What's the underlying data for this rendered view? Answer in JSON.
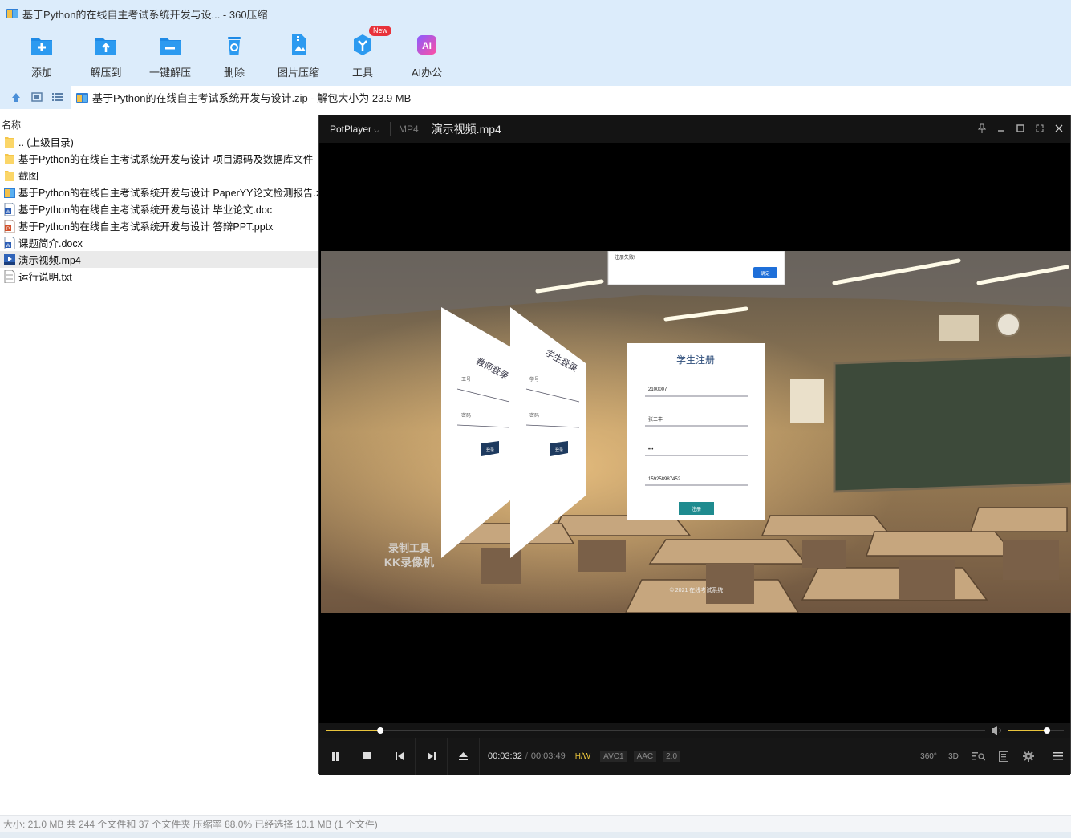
{
  "window": {
    "title": "基于Python的在线自主考试系统开发与设... - 360压缩"
  },
  "toolbar": {
    "items": [
      {
        "label": "添加",
        "icon": "add-icon"
      },
      {
        "label": "解压到",
        "icon": "extract-to-icon"
      },
      {
        "label": "一键解压",
        "icon": "one-click-extract-icon"
      },
      {
        "label": "删除",
        "icon": "delete-icon"
      },
      {
        "label": "图片压缩",
        "icon": "image-compress-icon"
      },
      {
        "label": "工具",
        "icon": "tools-icon",
        "badge": "New"
      },
      {
        "label": "AI办公",
        "icon": "ai-office-icon",
        "glyph": "AI"
      }
    ]
  },
  "address": {
    "path": "基于Python的在线自主考试系统开发与设计.zip - 解包大小为 23.9 MB"
  },
  "filelist": {
    "column_name": "名称",
    "rows": [
      {
        "name": ".. (上级目录)",
        "type": "folder"
      },
      {
        "name": "基于Python的在线自主考试系统开发与设计 项目源码及数据库文件",
        "type": "folder"
      },
      {
        "name": "截图",
        "type": "folder"
      },
      {
        "name": "基于Python的在线自主考试系统开发与设计 PaperYY论文检测报告.zip",
        "type": "zip"
      },
      {
        "name": "基于Python的在线自主考试系统开发与设计 毕业论文.doc",
        "type": "doc"
      },
      {
        "name": "基于Python的在线自主考试系统开发与设计 答辩PPT.pptx",
        "type": "ppt"
      },
      {
        "name": "课题简介.docx",
        "type": "doc"
      },
      {
        "name": "演示视频.mp4",
        "type": "mp4",
        "selected": true
      },
      {
        "name": "运行说明.txt",
        "type": "txt"
      }
    ]
  },
  "status": {
    "text": "大小: 21.0 MB 共 244 个文件和 37 个文件夹 压缩率 88.0% 已经选择 10.1 MB (1 个文件)"
  },
  "player": {
    "brand": "PotPlayer",
    "format": "MP4",
    "filename": "演示视频.mp4",
    "progress_fraction": 0.0829,
    "volume_fraction": 0.7,
    "time_current": "00:03:32",
    "time_separator": "/",
    "time_total": "00:03:49",
    "tags": [
      "H/W",
      "AVC1",
      "AAC",
      "2.0"
    ],
    "right_icons": [
      "360°",
      "3D"
    ],
    "video": {
      "alert_text": "注册失败!",
      "alert_button": "确定",
      "panel_teacher": "教师登录",
      "panel_student": "学生登录",
      "field_jobno": "工号",
      "field_studentno": "学号",
      "field_password": "密码",
      "login_button": "登录",
      "register_title": "学生注册",
      "register_values": [
        "2100007",
        "张三丰",
        "•••",
        "159258987452"
      ],
      "register_button": "注册",
      "watermark_line1": "录制工具",
      "watermark_line2": "KK录像机",
      "copyright": "© 2021 在线考试系统"
    }
  }
}
